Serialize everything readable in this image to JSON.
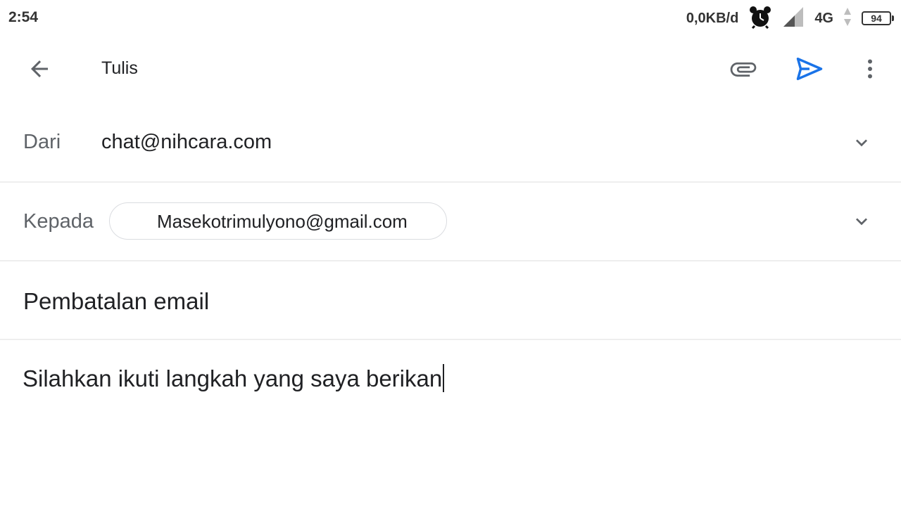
{
  "status_bar": {
    "time": "2:54",
    "net_speed": "0,0KB/d",
    "net_type": "4G",
    "battery": "94",
    "icons": [
      "alarm-icon",
      "signal-icon",
      "data-arrows-icon",
      "battery-icon"
    ]
  },
  "toolbar": {
    "title": "Tulis",
    "icons": [
      "back-arrow-icon",
      "attach-icon",
      "send-icon",
      "more-vert-icon"
    ],
    "send_color": "#1a73e8"
  },
  "compose": {
    "from_label": "Dari",
    "from_value": "chat@nihcara.com",
    "to_label": "Kepada",
    "to_recipient": "Masekotrimulyono@gmail.com",
    "subject": "Pembatalan email",
    "body": "Silahkan ikuti langkah yang saya berikan"
  }
}
